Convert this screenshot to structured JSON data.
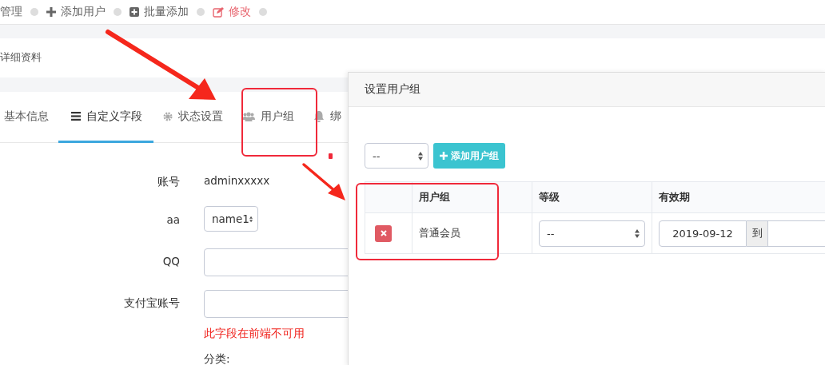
{
  "breadcrumb": [
    {
      "label": "管理",
      "selected": false
    },
    {
      "label": "添加用户",
      "selected": false
    },
    {
      "label": "批量添加",
      "selected": false
    },
    {
      "label": "修改",
      "selected": true
    }
  ],
  "section_title": "详细资料",
  "tabs": [
    {
      "label": "基本信息",
      "selected": false
    },
    {
      "label": "自定义字段",
      "selected": true
    },
    {
      "label": "状态设置",
      "selected": false
    },
    {
      "label": "用户组",
      "selected": false
    },
    {
      "label": "绑",
      "selected": false
    }
  ],
  "form": [
    {
      "kind": "text",
      "label": "账号",
      "value": "adminxxxxx"
    },
    {
      "kind": "select",
      "label": "aa",
      "value": "name1"
    },
    {
      "kind": "input",
      "label": "QQ"
    },
    {
      "kind": "input",
      "label": "支付宝账号",
      "error": "此字段在前端不可用"
    },
    {
      "kind": "category",
      "value": "分类:"
    }
  ],
  "modal": {
    "title": "设置用户组",
    "group_select": {
      "value": "--"
    },
    "add_button": "添加用户组",
    "table": {
      "columns": [
        "用户组",
        "等级",
        "有效期"
      ],
      "rows": [
        {
          "group": "普通会员",
          "level_select": "--",
          "date_from": "2019-09-12",
          "range_separator": "到"
        }
      ]
    }
  }
}
